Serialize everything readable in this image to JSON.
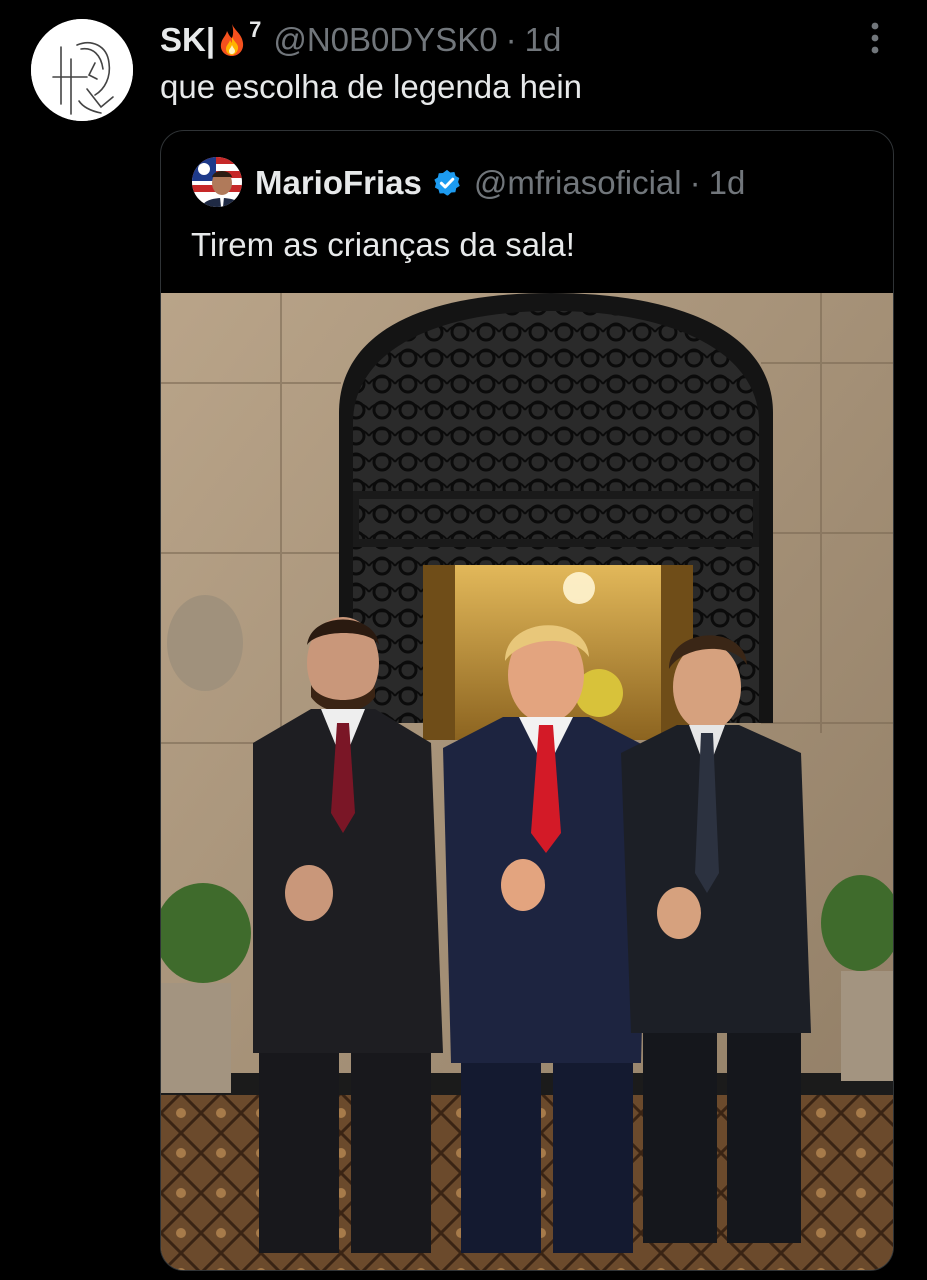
{
  "reply": {
    "display_name": "SK|",
    "name_emoji": "fire-icon",
    "name_superscript": "7",
    "handle": "@N0B0DYSK0",
    "separator": "·",
    "time": "1d",
    "text": "que escolha de legenda hein"
  },
  "quoted": {
    "display_name": "MarioFrias",
    "verified_icon": "verified-badge-icon",
    "handle": "@mfriasoficial",
    "separator": "·",
    "time": "1d",
    "text": "Tirem as crianças da sala!",
    "photo_alt": "photo"
  },
  "colors": {
    "background": "#000000",
    "primary_text": "#e7e9ea",
    "secondary_text": "#71767b",
    "border": "#2f3336",
    "verified": "#1d9bf0"
  }
}
